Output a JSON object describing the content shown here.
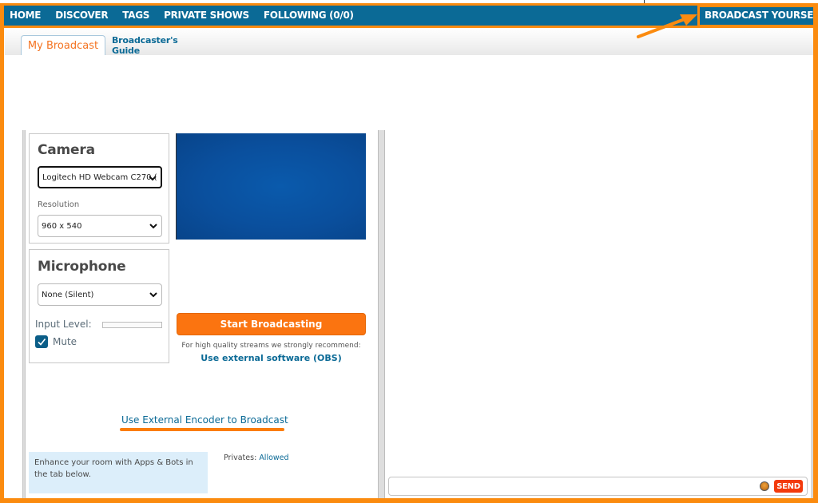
{
  "topnav": {
    "links": [
      "HOME",
      "DISCOVER",
      "TAGS",
      "PRIVATE SHOWS",
      "FOLLOWING (0/0)"
    ],
    "broadcast_label": "BROADCAST YOURSELF"
  },
  "tabs": [
    {
      "label": "My Broadcast",
      "active": true
    },
    {
      "label": "Broadcaster's Guide",
      "active": false
    }
  ],
  "camera": {
    "title": "Camera",
    "device": "Logitech HD Webcam C270 (",
    "resolution_label": "Resolution",
    "resolution": "960 x 540"
  },
  "microphone": {
    "title": "Microphone",
    "device": "None (Silent)",
    "input_level_label": "Input Level:",
    "input_level": 0,
    "mute_label": "Mute",
    "mute_checked": true
  },
  "broadcast": {
    "start_label": "Start Broadcasting",
    "recommend_text": "For high quality streams we strongly recommend:",
    "obs_link": "Use external software (OBS)",
    "encoder_link": "Use External Encoder to Broadcast"
  },
  "info": {
    "apps_text": "Enhance your room with Apps & Bots in the tab below.",
    "privates_label": "Privates:",
    "privates_value": "Allowed"
  },
  "chat": {
    "input_value": "",
    "emoji_icon": "emoji-icon",
    "send_label": "SEND"
  },
  "colors": {
    "nav_bg": "#0b6a96",
    "accent_orange": "#fb7410",
    "annotation_orange": "#fb8b0f",
    "send_red": "#f33a0c",
    "link_blue": "#0b6a96"
  }
}
